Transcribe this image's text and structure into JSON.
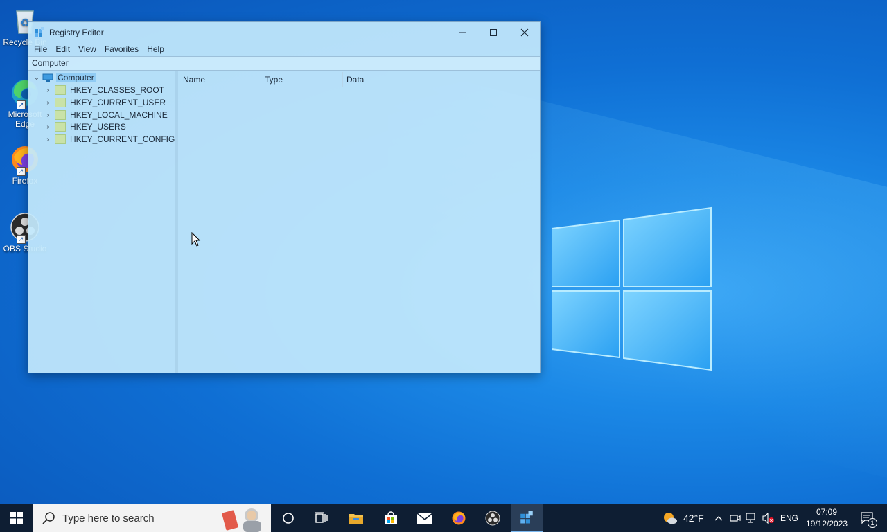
{
  "desktop": {
    "icons": [
      {
        "label": "Recycle Bin",
        "icon": "recycle-bin-icon"
      },
      {
        "label": "Microsoft Edge",
        "icon": "edge-icon"
      },
      {
        "label": "Firefox",
        "icon": "firefox-icon"
      },
      {
        "label": "OBS Studio",
        "icon": "obs-icon"
      }
    ]
  },
  "window": {
    "title": "Registry Editor",
    "menu": [
      "File",
      "Edit",
      "View",
      "Favorites",
      "Help"
    ],
    "address": "Computer",
    "tree": {
      "root": "Computer",
      "children": [
        "HKEY_CLASSES_ROOT",
        "HKEY_CURRENT_USER",
        "HKEY_LOCAL_MACHINE",
        "HKEY_USERS",
        "HKEY_CURRENT_CONFIG"
      ]
    },
    "columns": [
      "Name",
      "Type",
      "Data"
    ]
  },
  "taskbar": {
    "search_placeholder": "Type here to search",
    "weather": "42°F",
    "language": "ENG",
    "time": "07:09",
    "date": "19/12/2023",
    "notification_count": "1"
  }
}
